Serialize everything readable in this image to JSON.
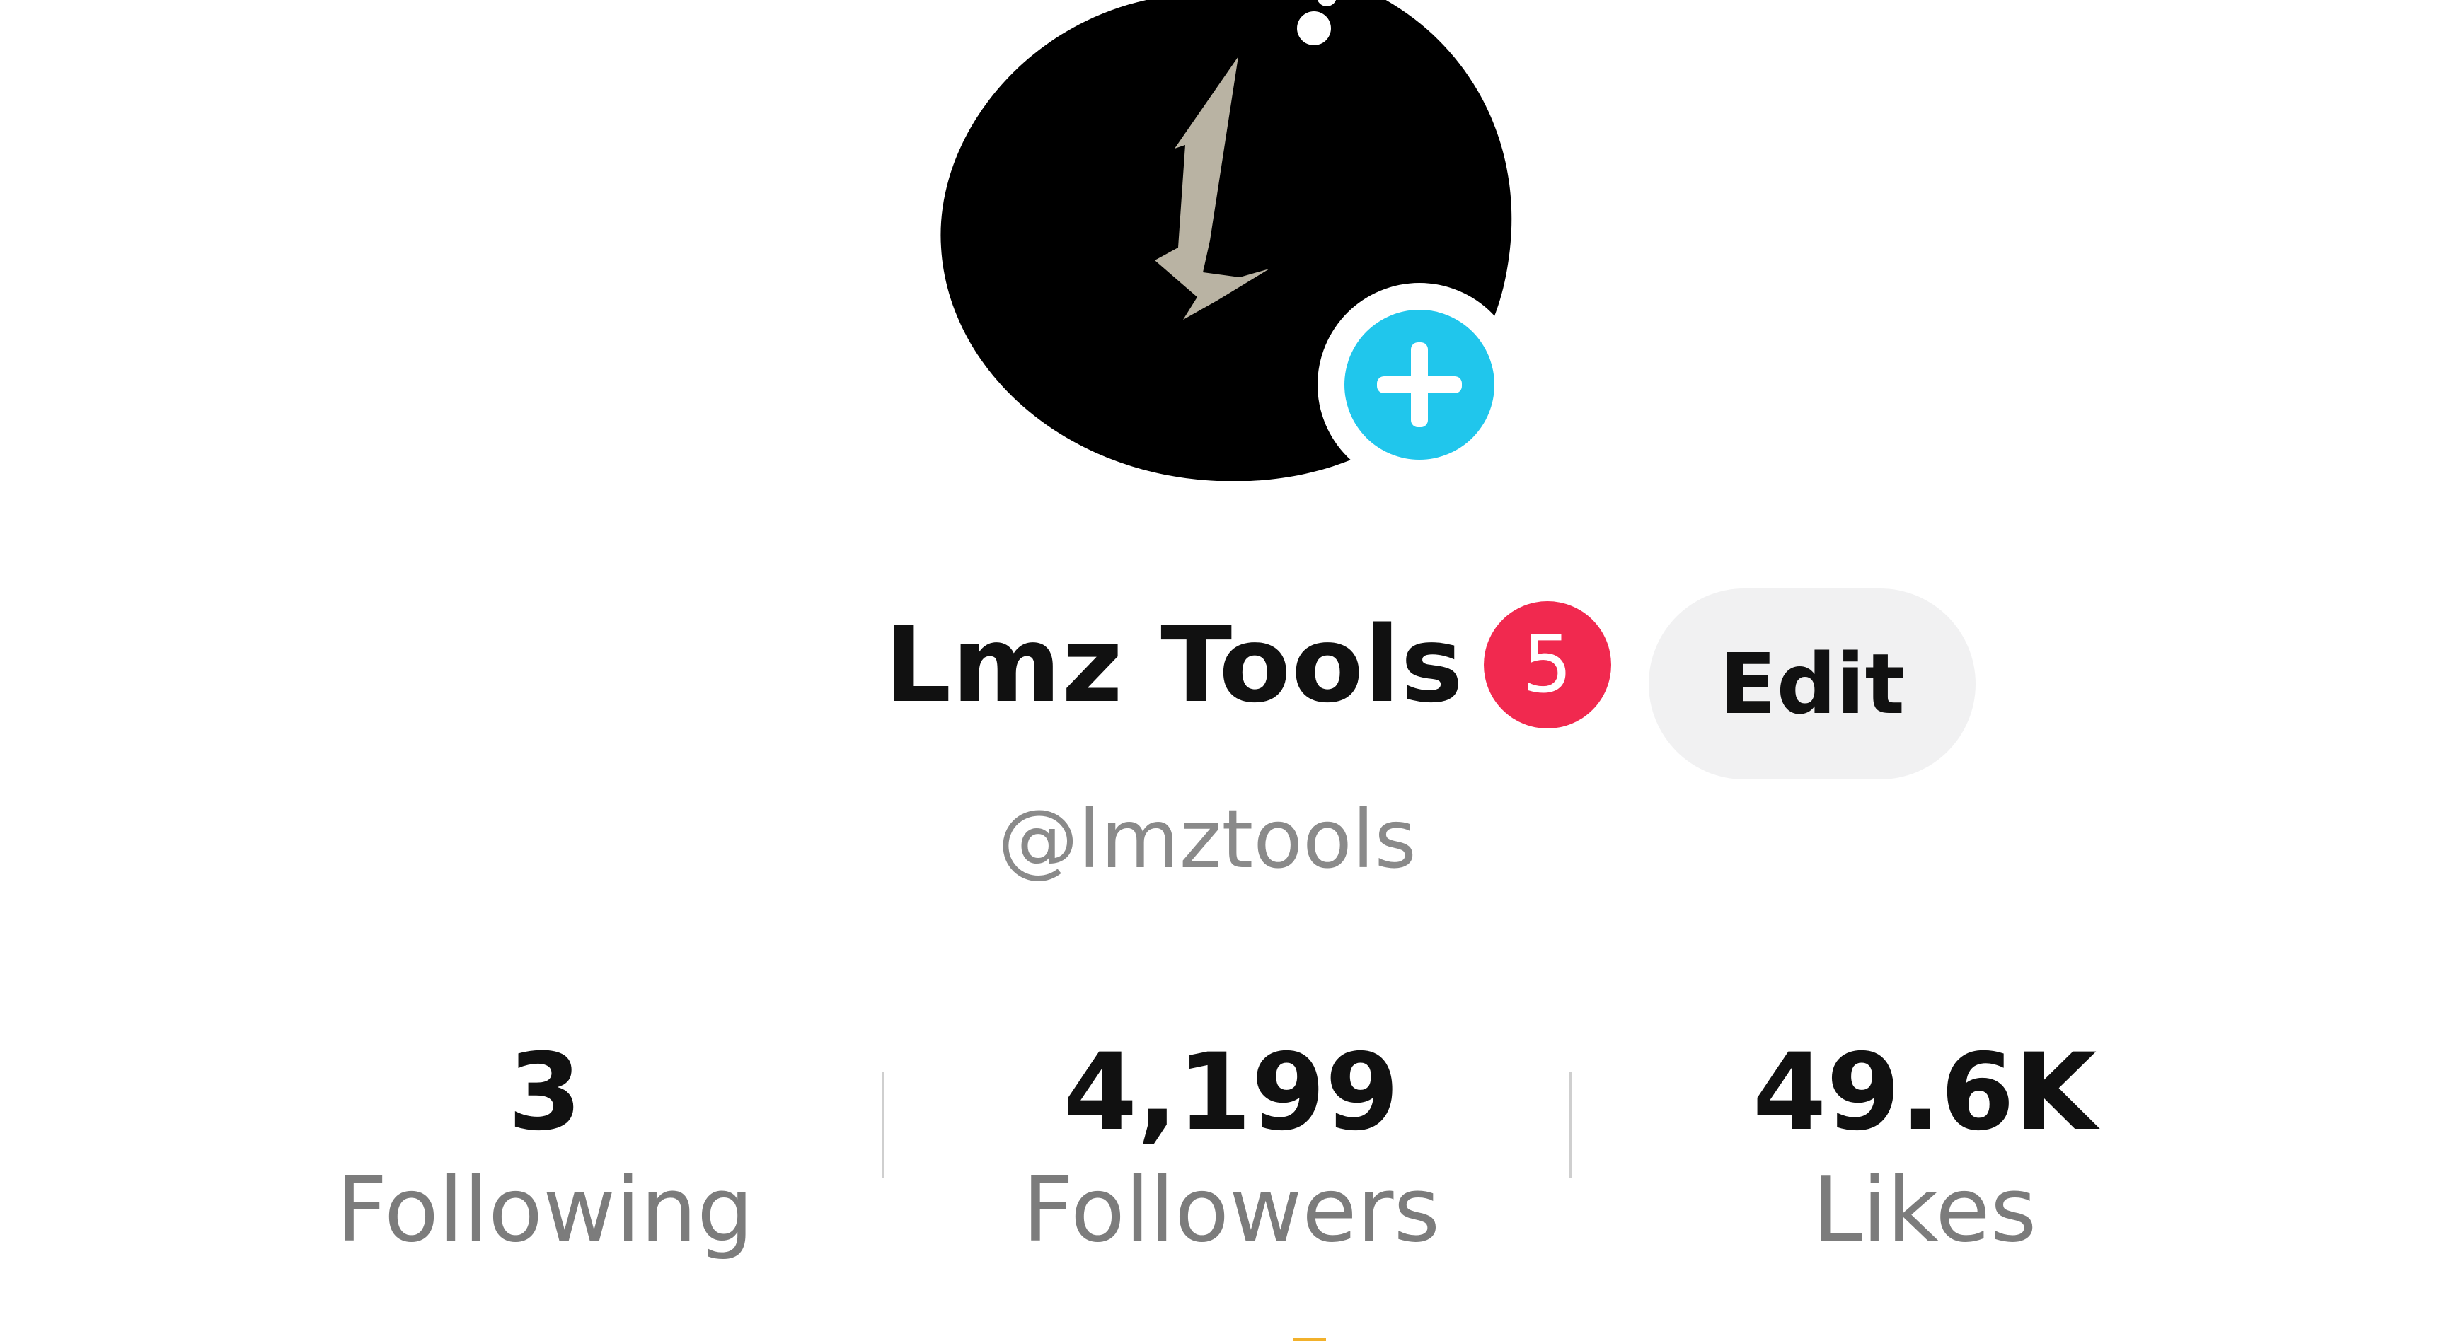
{
  "profile": {
    "display_name": "Lmz Tools",
    "notification_count": "5",
    "handle": "@lmztools",
    "edit_label": "Edit"
  },
  "stats": [
    {
      "value": "3",
      "label": "Following"
    },
    {
      "value": "4,199",
      "label": "Followers"
    },
    {
      "value": "49.6K",
      "label": "Likes"
    }
  ],
  "icons": {
    "avatar": "lightning-bolt-logo",
    "add": "plus-icon"
  },
  "colors": {
    "accent_blue": "#20c6ec",
    "badge_red": "#f1294f",
    "edit_bg": "#f1f1f2",
    "text_primary": "#111111",
    "text_secondary": "#7c7c7c"
  }
}
